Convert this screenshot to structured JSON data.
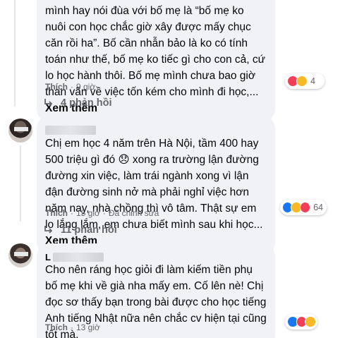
{
  "comment1": {
    "text": "mình hay nói đùa với bố mẹ là “bố mẹ ko nuôi con học chắc giờ xây được mấy chục căn rồi ha”. Bố cần nhẫn bảo là ko có tính toán như thế, bố mẹ ko tiếc gì cho con cả, cứ lo học hành thôi. Bố mẹ mình chưa bao giờ than vãn về việc tốn kém cho mình đi học,... ",
    "see_more": "Xem thêm",
    "like_label": "Thích",
    "time": "9 giờ",
    "reaction_count": "4",
    "replies": "4 phản hồi"
  },
  "comment2": {
    "text": "Chị em học 4 năm trên Hà Nội, tầm 400 hay 500 triệu gì đó 😞 xong ra trường lận đường đường xin việc, làm trái ngành xong vì lận đận đường sinh nở mà phải nghỉ việc hơn năm nay, nhà chồng thì vô tâm. Thật sự em lo lắng lắm, em chưa biết mình sau khi học... ",
    "see_more": "Xem thêm",
    "like_label": "Thích",
    "time": "15 giờ",
    "edited": "Đã chỉnh sửa",
    "reaction_count": "64",
    "replies": "11 phản hồi"
  },
  "comment3": {
    "author_initial": "L",
    "text": "Cho nên ráng học giỏi đi làm kiếm tiền phụ bố mẹ khi về già nha mấy em. Cố lên nè! Chị đọc sơ thấy bạn trong bài được cho học tiếng Anh tiếng Nhật nữa nên chắc cv hiện tại cũng tốt mà.",
    "like_label": "Thích",
    "time": "13 giờ"
  },
  "colors": {
    "bubble": "#f0f2f5",
    "meta": "#65676b",
    "love": "#f33e58",
    "haha": "#f7b928",
    "like": "#1877f2"
  }
}
